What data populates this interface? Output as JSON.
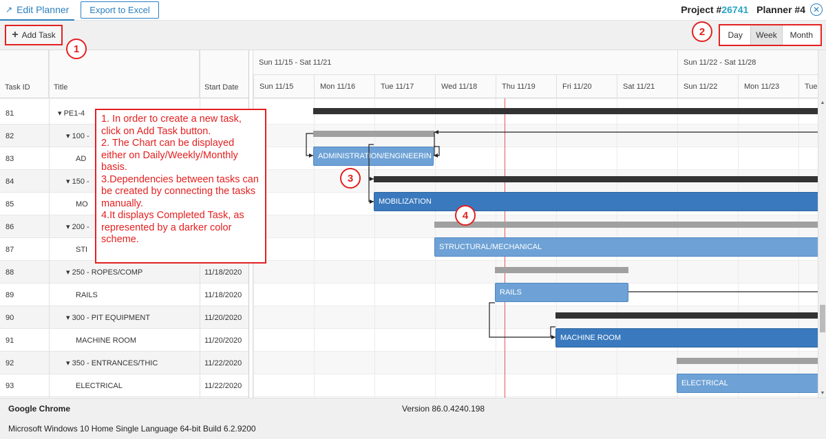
{
  "header": {
    "edit_tab": "Edit Planner",
    "export_button": "Export to Excel",
    "project_label": "Project #",
    "project_number": "26741",
    "planner_label": "Planner #4"
  },
  "toolbar": {
    "add_task": "Add Task",
    "views": [
      "Day",
      "Week",
      "Month"
    ],
    "active_view": "Week"
  },
  "badges": [
    "1",
    "2",
    "3",
    "4"
  ],
  "grid": {
    "columns": [
      "Task ID",
      "Title",
      "Start Date"
    ],
    "rows": [
      {
        "id": "81",
        "title": "▾ PE1-4",
        "start": ""
      },
      {
        "id": "82",
        "title": "▾ 100 -",
        "start": ""
      },
      {
        "id": "83",
        "title": "AD",
        "start": ""
      },
      {
        "id": "84",
        "title": "▾ 150 -",
        "start": ""
      },
      {
        "id": "85",
        "title": "MO",
        "start": ""
      },
      {
        "id": "86",
        "title": "▾ 200 -",
        "start": ""
      },
      {
        "id": "87",
        "title": "STI",
        "start": ""
      },
      {
        "id": "88",
        "title": "▾ 250 - ROPES/COMP",
        "start": "11/18/2020"
      },
      {
        "id": "89",
        "title": "RAILS",
        "start": "11/18/2020"
      },
      {
        "id": "90",
        "title": "▾ 300 - PIT EQUIPMENT",
        "start": "11/20/2020"
      },
      {
        "id": "91",
        "title": "MACHINE ROOM",
        "start": "11/20/2020"
      },
      {
        "id": "92",
        "title": "▾ 350 - ENTRANCES/THIC",
        "start": "11/22/2020"
      },
      {
        "id": "93",
        "title": "ELECTRICAL",
        "start": "11/22/2020"
      }
    ]
  },
  "gantt": {
    "weeks": [
      "Sun 11/15 - Sat 11/21",
      "Sun 11/22 - Sat 11/28"
    ],
    "days": [
      "Sun 11/15",
      "Mon 11/16",
      "Tue 11/17",
      "Wed 11/18",
      "Thu 11/19",
      "Fri 11/20",
      "Sat 11/21",
      "Sun 11/22",
      "Mon 11/23",
      "Tue"
    ],
    "tasks": [
      "ADMINISTRATION/ENGINEERIN",
      "MOBILIZATION",
      "STRUCTURAL/MECHANICAL",
      "RAILS",
      "MACHINE ROOM",
      "ELECTRICAL"
    ]
  },
  "annotation": {
    "lines": [
      "1. In order to create a new task, click on Add Task button.",
      "2. The Chart can be displayed either on Daily/Weekly/Monthly basis.",
      "3.Dependencies between tasks can be created by connecting the tasks manually.",
      "4.It displays Completed Task, as represented by a darker color scheme."
    ]
  },
  "footer": {
    "app_name": "Google Chrome",
    "version": "Version 86.0.4240.198",
    "os": "Microsoft Windows 10 Home Single Language 64-bit Build 6.2.9200"
  }
}
